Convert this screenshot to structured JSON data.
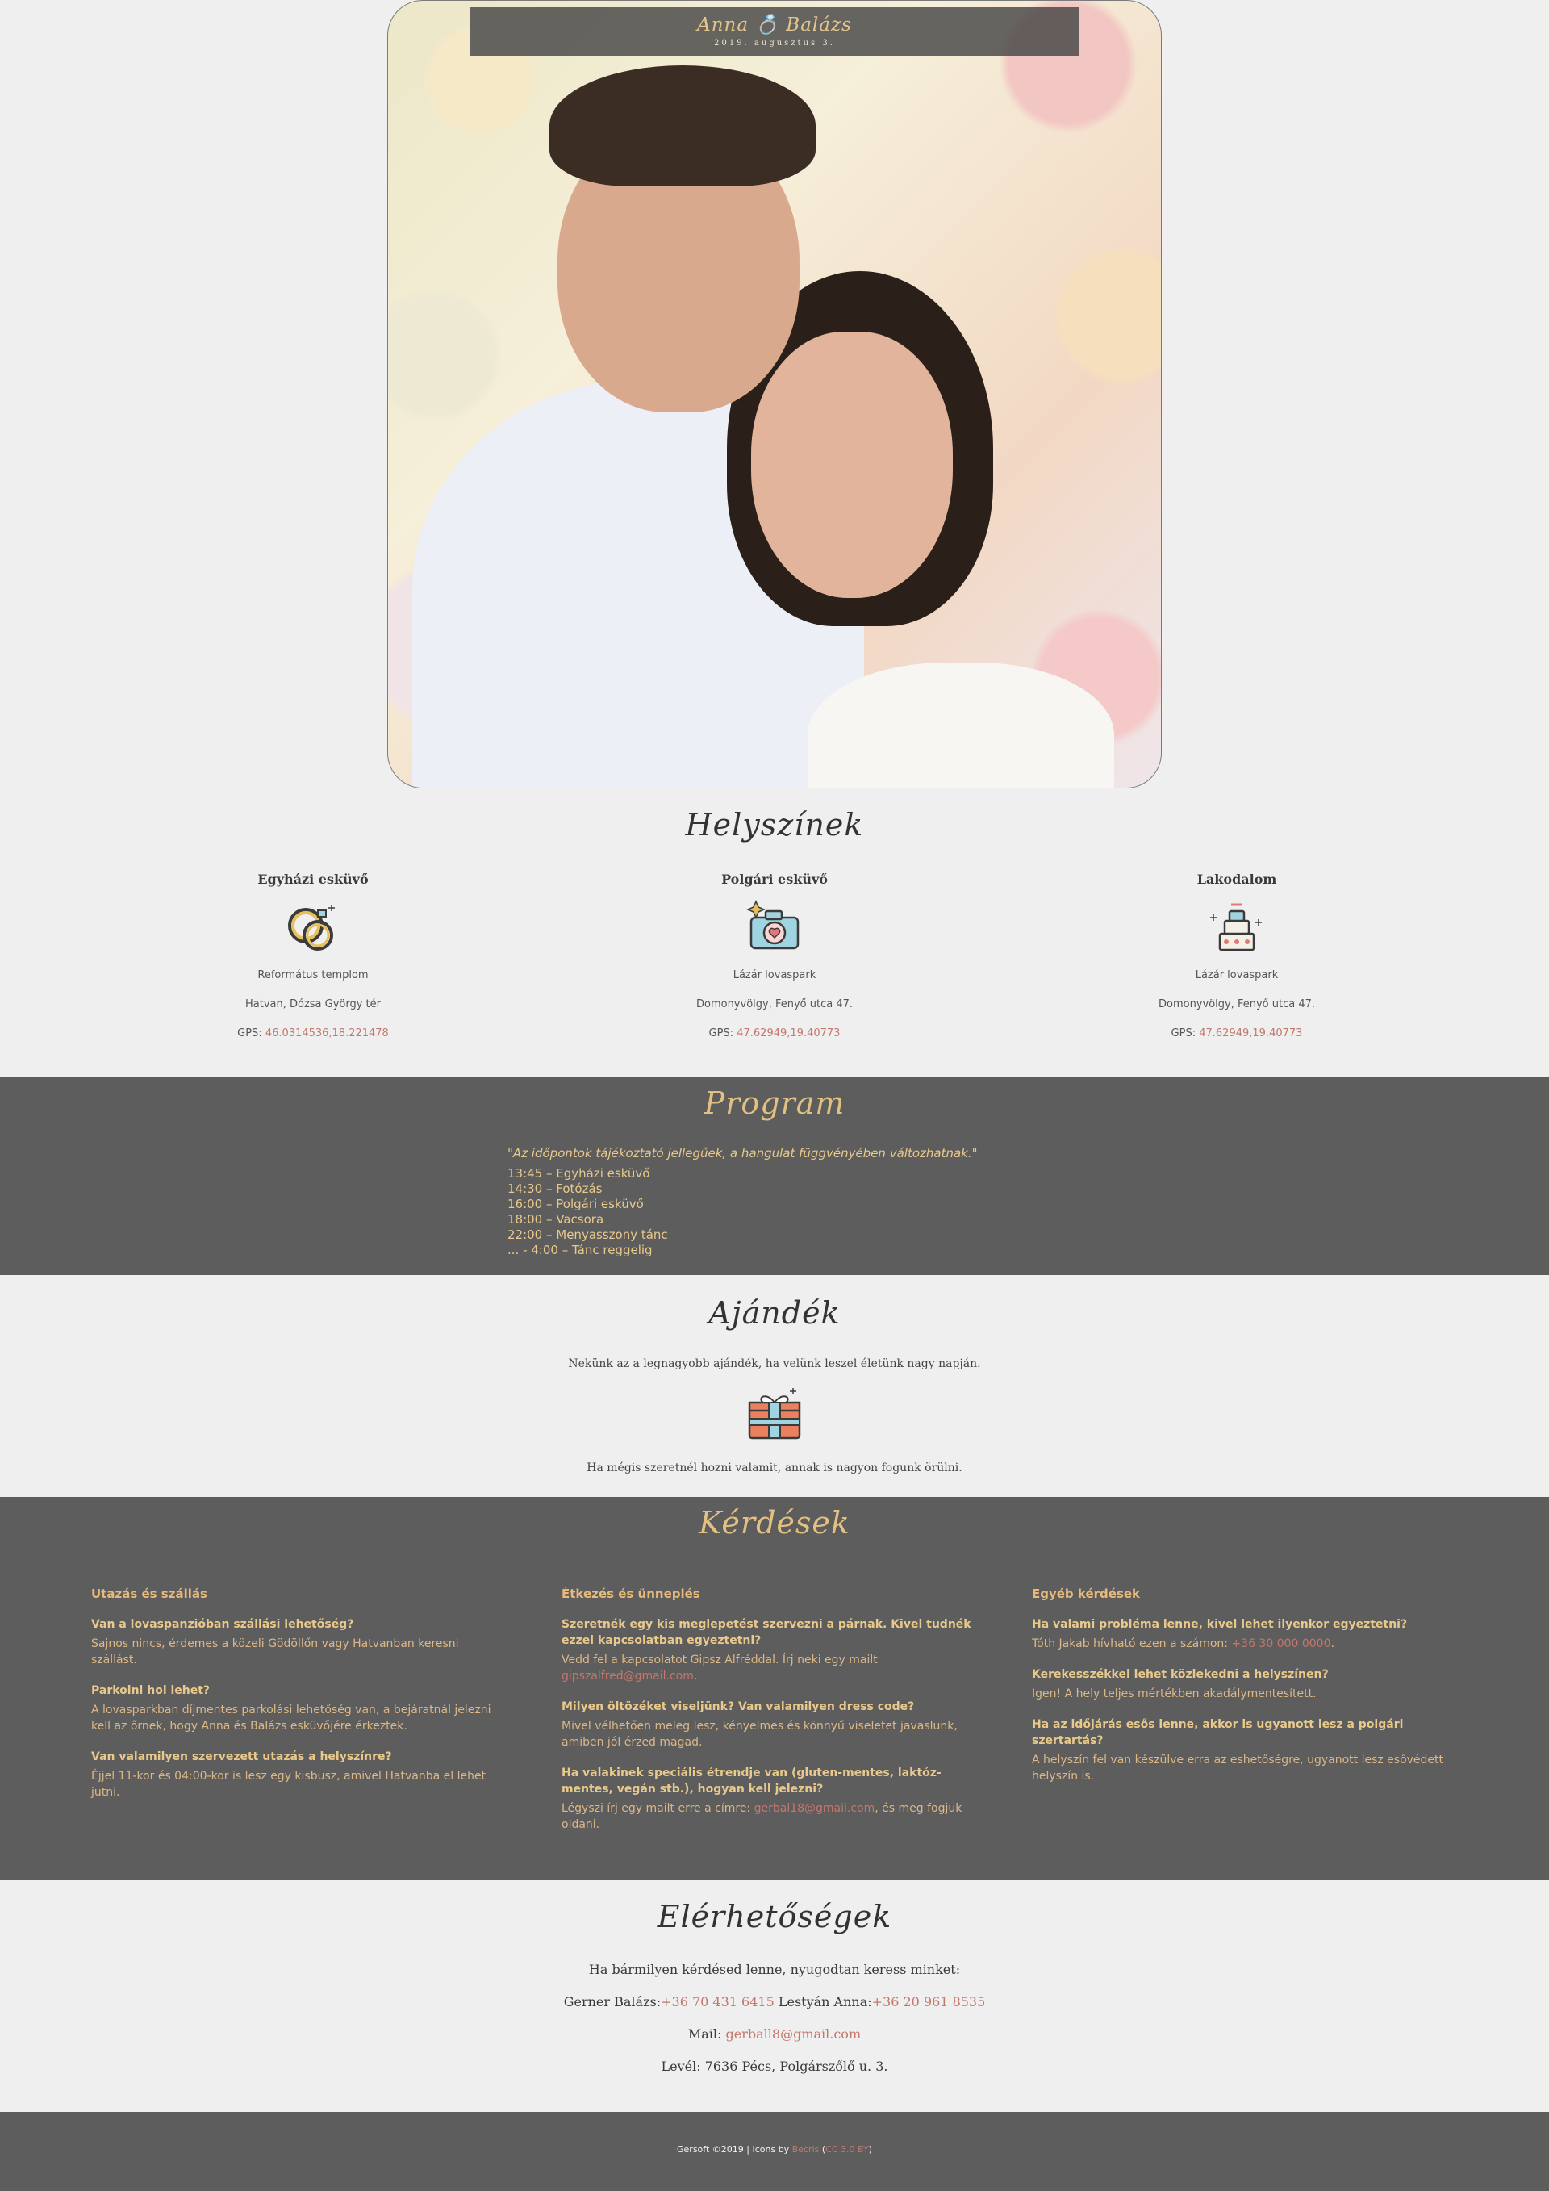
{
  "hero": {
    "title": "Anna 💍 Balázs",
    "date": "2019. augusztus 3."
  },
  "locations": {
    "title": "Helyszínek",
    "items": [
      {
        "heading": "Egyházi esküvő",
        "icon": "rings-icon",
        "place": "Református templom",
        "address": "Hatvan, Dózsa György tér",
        "gps_label": "GPS:",
        "gps": "46.0314536,18.221478"
      },
      {
        "heading": "Polgári esküvő",
        "icon": "camera-icon",
        "place": "Lázár lovaspark",
        "address": "Domonyvölgy, Fenyő utca 47.",
        "gps_label": "GPS:",
        "gps": "47.62949,19.40773"
      },
      {
        "heading": "Lakodalom",
        "icon": "wedding-cake-icon",
        "place": "Lázár lovaspark",
        "address": "Domonyvölgy, Fenyő utca 47.",
        "gps_label": "GPS:",
        "gps": "47.62949,19.40773"
      }
    ]
  },
  "program": {
    "title": "Program",
    "note": "\"Az időpontok tájékoztató jellegűek, a hangulat függvényében változhatnak.\"",
    "items": [
      "13:45 – Egyházi esküvő",
      "14:30 – Fotózás",
      "16:00 – Polgári esküvő",
      "18:00 – Vacsora",
      "22:00 – Menyasszony tánc",
      "... - 4:00 – Tánc reggelig"
    ]
  },
  "gift": {
    "title": "Ajándék",
    "line1": "Nekünk az a legnagyobb ajándék, ha velünk leszel életünk nagy napján.",
    "icon": "gift-icon",
    "line2": "Ha mégis szeretnél hozni valamit, annak is nagyon fogunk örülni."
  },
  "faq": {
    "title": "Kérdések",
    "columns": [
      {
        "heading": "Utazás és szállás",
        "items": [
          {
            "q": "Van a lovaspanzióban szállási lehetőség?",
            "a": "Sajnos nincs, érdemes a közeli Gödöllőn vagy Hatvanban keresni szállást."
          },
          {
            "q": "Parkolni hol lehet?",
            "a": "A lovasparkban díjmentes parkolási lehetőség van, a bejáratnál jelezni kell az őrnek, hogy Anna és Balázs esküvőjére érkeztek."
          },
          {
            "q": "Van valamilyen szervezett utazás a helyszínre?",
            "a": "Éjjel 11-kor és 04:00-kor is lesz egy kisbusz, amivel Hatvanba el lehet jutni."
          }
        ]
      },
      {
        "heading": "Étkezés és ünneplés",
        "items": [
          {
            "q": "Szeretnék egy kis meglepetést szervezni a párnak. Kivel tudnék ezzel kapcsolatban egyeztetni?",
            "a": "Vedd fel a kapcsolatot Gipsz Alfréddal. Írj neki egy mailt",
            "link": "gipszalfred@gmail.com",
            "after": "."
          },
          {
            "q": "Milyen öltözéket viseljünk? Van valamilyen dress code?",
            "a": "Mivel vélhetően meleg lesz, kényelmes és könnyű viseletet javaslunk, amiben jól érzed magad."
          },
          {
            "q": "Ha valakinek speciális étrendje van (gluten-mentes, laktóz-mentes, vegán stb.), hogyan kell jelezni?",
            "a": "Légyszi írj egy mailt erre a címre:",
            "link": "gerbal18@gmail.com",
            "after": ", és meg fogjuk oldani."
          }
        ]
      },
      {
        "heading": "Egyéb kérdések",
        "items": [
          {
            "q": "Ha valami probléma lenne, kivel lehet ilyenkor egyeztetni?",
            "a": "Tóth Jakab hívható ezen a számon:",
            "link": "+36 30 000 0000",
            "after": "."
          },
          {
            "q": "Kerekesszékkel lehet közlekedni a helyszínen?",
            "a": "Igen! A hely teljes mértékben akadálymentesített."
          },
          {
            "q": "Ha az időjárás esős lenne, akkor is ugyanott lesz a polgári szertartás?",
            "a": "A helyszín fel van készülve erra az eshetőségre, ugyanott lesz esővédett helyszín is."
          }
        ]
      }
    ]
  },
  "contact": {
    "title": "Elérhetőségek",
    "intro": "Ha bármilyen kérdésed lenne, nyugodtan keress minket:",
    "person1_label": "Gerner Balázs:",
    "person1_phone": "+36 70 431 6415",
    "person2_label": "Lestyán Anna:",
    "person2_phone": "+36 20 961 8535",
    "mail_label": "Mail:",
    "mail": "gerball8@gmail.com",
    "letter": "Levél: 7636 Pécs, Polgárszőlő u. 3."
  },
  "footer": {
    "text": "Gersoft ©2019 | Icons by",
    "icons_link": "Becris",
    "license_open": "(",
    "license_link": "CC 3.0 BY",
    "license_close": ")"
  },
  "colors": {
    "accent": "#e2c081",
    "link": "#c4776b",
    "dark_band": "#5d5d5d",
    "page_bg": "#efefef"
  }
}
